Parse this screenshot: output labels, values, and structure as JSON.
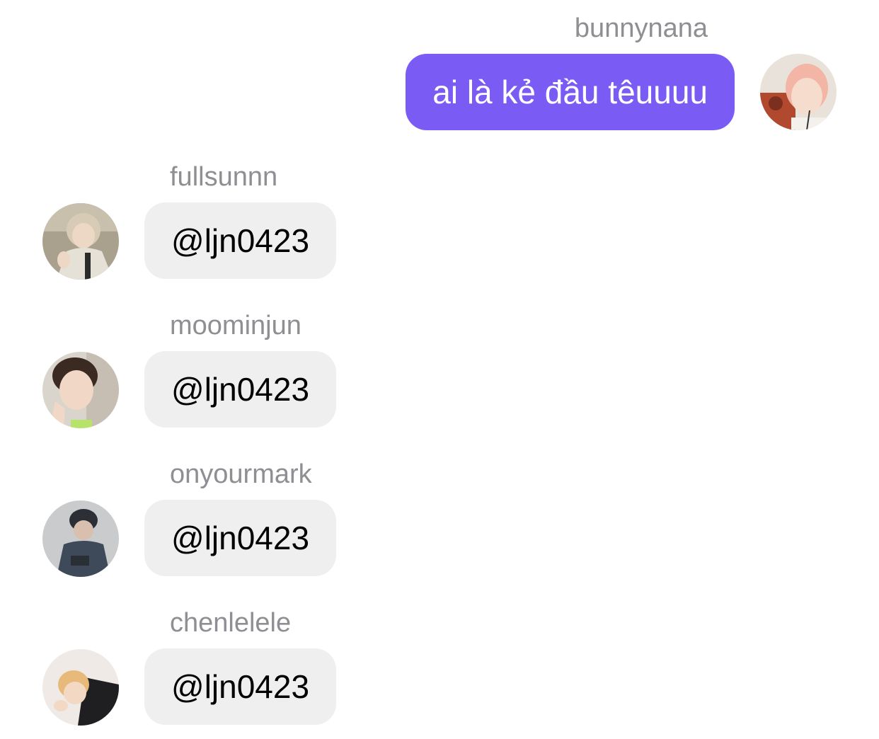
{
  "messages": [
    {
      "sender": "bunnynana",
      "text": "ai là kẻ đầu têuuuu",
      "direction": "outgoing",
      "avatar_icon": "profile-photo-pink-hair",
      "bubble_color": "#7a5cf5"
    },
    {
      "sender": "fullsunnn",
      "text": "@ljn0423",
      "direction": "incoming",
      "avatar_icon": "profile-photo-outdoor",
      "bubble_color": "#efefef"
    },
    {
      "sender": "moominjun",
      "text": "@ljn0423",
      "direction": "incoming",
      "avatar_icon": "profile-photo-selfie",
      "bubble_color": "#efefef"
    },
    {
      "sender": "onyourmark",
      "text": "@ljn0423",
      "direction": "incoming",
      "avatar_icon": "profile-photo-beanie",
      "bubble_color": "#efefef"
    },
    {
      "sender": "chenlelele",
      "text": "@ljn0423",
      "direction": "incoming",
      "avatar_icon": "profile-photo-lying",
      "bubble_color": "#efefef"
    }
  ],
  "colors": {
    "name_gray": "#8e8e93",
    "outgoing_bubble": "#7a5cf5",
    "incoming_bubble": "#efefef"
  }
}
